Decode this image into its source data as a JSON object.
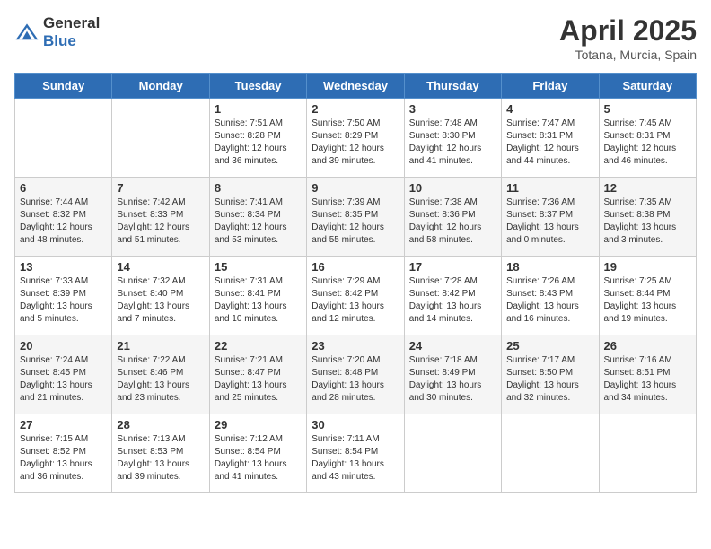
{
  "header": {
    "logo_general": "General",
    "logo_blue": "Blue",
    "month_title": "April 2025",
    "location": "Totana, Murcia, Spain"
  },
  "weekdays": [
    "Sunday",
    "Monday",
    "Tuesday",
    "Wednesday",
    "Thursday",
    "Friday",
    "Saturday"
  ],
  "weeks": [
    [
      {
        "day": "",
        "details": ""
      },
      {
        "day": "",
        "details": ""
      },
      {
        "day": "1",
        "details": "Sunrise: 7:51 AM\nSunset: 8:28 PM\nDaylight: 12 hours and 36 minutes."
      },
      {
        "day": "2",
        "details": "Sunrise: 7:50 AM\nSunset: 8:29 PM\nDaylight: 12 hours and 39 minutes."
      },
      {
        "day": "3",
        "details": "Sunrise: 7:48 AM\nSunset: 8:30 PM\nDaylight: 12 hours and 41 minutes."
      },
      {
        "day": "4",
        "details": "Sunrise: 7:47 AM\nSunset: 8:31 PM\nDaylight: 12 hours and 44 minutes."
      },
      {
        "day": "5",
        "details": "Sunrise: 7:45 AM\nSunset: 8:31 PM\nDaylight: 12 hours and 46 minutes."
      }
    ],
    [
      {
        "day": "6",
        "details": "Sunrise: 7:44 AM\nSunset: 8:32 PM\nDaylight: 12 hours and 48 minutes."
      },
      {
        "day": "7",
        "details": "Sunrise: 7:42 AM\nSunset: 8:33 PM\nDaylight: 12 hours and 51 minutes."
      },
      {
        "day": "8",
        "details": "Sunrise: 7:41 AM\nSunset: 8:34 PM\nDaylight: 12 hours and 53 minutes."
      },
      {
        "day": "9",
        "details": "Sunrise: 7:39 AM\nSunset: 8:35 PM\nDaylight: 12 hours and 55 minutes."
      },
      {
        "day": "10",
        "details": "Sunrise: 7:38 AM\nSunset: 8:36 PM\nDaylight: 12 hours and 58 minutes."
      },
      {
        "day": "11",
        "details": "Sunrise: 7:36 AM\nSunset: 8:37 PM\nDaylight: 13 hours and 0 minutes."
      },
      {
        "day": "12",
        "details": "Sunrise: 7:35 AM\nSunset: 8:38 PM\nDaylight: 13 hours and 3 minutes."
      }
    ],
    [
      {
        "day": "13",
        "details": "Sunrise: 7:33 AM\nSunset: 8:39 PM\nDaylight: 13 hours and 5 minutes."
      },
      {
        "day": "14",
        "details": "Sunrise: 7:32 AM\nSunset: 8:40 PM\nDaylight: 13 hours and 7 minutes."
      },
      {
        "day": "15",
        "details": "Sunrise: 7:31 AM\nSunset: 8:41 PM\nDaylight: 13 hours and 10 minutes."
      },
      {
        "day": "16",
        "details": "Sunrise: 7:29 AM\nSunset: 8:42 PM\nDaylight: 13 hours and 12 minutes."
      },
      {
        "day": "17",
        "details": "Sunrise: 7:28 AM\nSunset: 8:42 PM\nDaylight: 13 hours and 14 minutes."
      },
      {
        "day": "18",
        "details": "Sunrise: 7:26 AM\nSunset: 8:43 PM\nDaylight: 13 hours and 16 minutes."
      },
      {
        "day": "19",
        "details": "Sunrise: 7:25 AM\nSunset: 8:44 PM\nDaylight: 13 hours and 19 minutes."
      }
    ],
    [
      {
        "day": "20",
        "details": "Sunrise: 7:24 AM\nSunset: 8:45 PM\nDaylight: 13 hours and 21 minutes."
      },
      {
        "day": "21",
        "details": "Sunrise: 7:22 AM\nSunset: 8:46 PM\nDaylight: 13 hours and 23 minutes."
      },
      {
        "day": "22",
        "details": "Sunrise: 7:21 AM\nSunset: 8:47 PM\nDaylight: 13 hours and 25 minutes."
      },
      {
        "day": "23",
        "details": "Sunrise: 7:20 AM\nSunset: 8:48 PM\nDaylight: 13 hours and 28 minutes."
      },
      {
        "day": "24",
        "details": "Sunrise: 7:18 AM\nSunset: 8:49 PM\nDaylight: 13 hours and 30 minutes."
      },
      {
        "day": "25",
        "details": "Sunrise: 7:17 AM\nSunset: 8:50 PM\nDaylight: 13 hours and 32 minutes."
      },
      {
        "day": "26",
        "details": "Sunrise: 7:16 AM\nSunset: 8:51 PM\nDaylight: 13 hours and 34 minutes."
      }
    ],
    [
      {
        "day": "27",
        "details": "Sunrise: 7:15 AM\nSunset: 8:52 PM\nDaylight: 13 hours and 36 minutes."
      },
      {
        "day": "28",
        "details": "Sunrise: 7:13 AM\nSunset: 8:53 PM\nDaylight: 13 hours and 39 minutes."
      },
      {
        "day": "29",
        "details": "Sunrise: 7:12 AM\nSunset: 8:54 PM\nDaylight: 13 hours and 41 minutes."
      },
      {
        "day": "30",
        "details": "Sunrise: 7:11 AM\nSunset: 8:54 PM\nDaylight: 13 hours and 43 minutes."
      },
      {
        "day": "",
        "details": ""
      },
      {
        "day": "",
        "details": ""
      },
      {
        "day": "",
        "details": ""
      }
    ]
  ]
}
